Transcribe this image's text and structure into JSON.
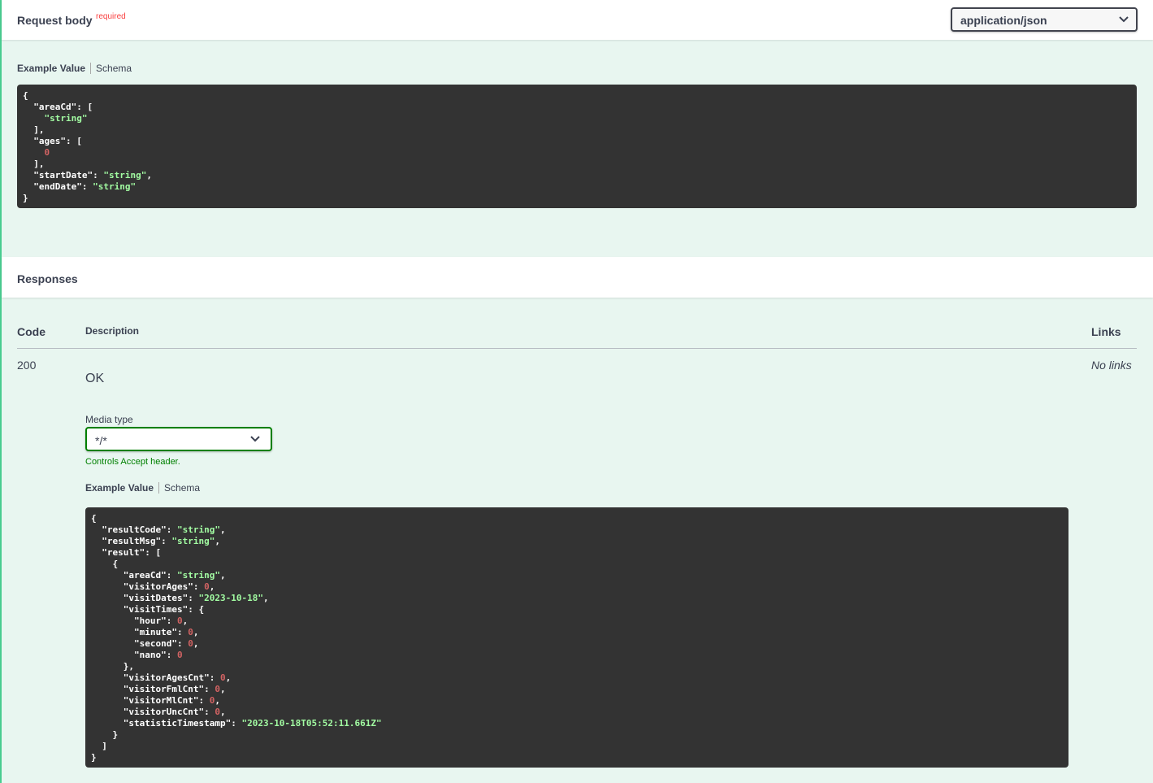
{
  "request_body": {
    "title": "Request body",
    "required": "required",
    "content_type": "application/json",
    "tabs": {
      "example": "Example Value",
      "schema": "Schema"
    },
    "code_lines": [
      [
        [
          "p",
          "{"
        ]
      ],
      [
        [
          "p",
          "  "
        ],
        [
          "k",
          "\"areaCd\""
        ],
        [
          "p",
          ": ["
        ]
      ],
      [
        [
          "p",
          "    "
        ],
        [
          "s",
          "\"string\""
        ]
      ],
      [
        [
          "p",
          "  ],"
        ]
      ],
      [
        [
          "p",
          "  "
        ],
        [
          "k",
          "\"ages\""
        ],
        [
          "p",
          ": ["
        ]
      ],
      [
        [
          "p",
          "    "
        ],
        [
          "n",
          "0"
        ]
      ],
      [
        [
          "p",
          "  ],"
        ]
      ],
      [
        [
          "p",
          "  "
        ],
        [
          "k",
          "\"startDate\""
        ],
        [
          "p",
          ": "
        ],
        [
          "s",
          "\"string\""
        ],
        [
          "p",
          ","
        ]
      ],
      [
        [
          "p",
          "  "
        ],
        [
          "k",
          "\"endDate\""
        ],
        [
          "p",
          ": "
        ],
        [
          "s",
          "\"string\""
        ]
      ],
      [
        [
          "p",
          "}"
        ]
      ]
    ]
  },
  "responses": {
    "title": "Responses",
    "columns": {
      "code": "Code",
      "description": "Description",
      "links": "Links"
    },
    "row": {
      "code": "200",
      "description": "OK",
      "links": "No links",
      "media_type_label": "Media type",
      "media_type": "*/*",
      "controls_accept": "Controls Accept header.",
      "tabs": {
        "example": "Example Value",
        "schema": "Schema"
      },
      "code_lines": [
        [
          [
            "p",
            "{"
          ]
        ],
        [
          [
            "p",
            "  "
          ],
          [
            "k",
            "\"resultCode\""
          ],
          [
            "p",
            ": "
          ],
          [
            "s",
            "\"string\""
          ],
          [
            "p",
            ","
          ]
        ],
        [
          [
            "p",
            "  "
          ],
          [
            "k",
            "\"resultMsg\""
          ],
          [
            "p",
            ": "
          ],
          [
            "s",
            "\"string\""
          ],
          [
            "p",
            ","
          ]
        ],
        [
          [
            "p",
            "  "
          ],
          [
            "k",
            "\"result\""
          ],
          [
            "p",
            ": ["
          ]
        ],
        [
          [
            "p",
            "    {"
          ]
        ],
        [
          [
            "p",
            "      "
          ],
          [
            "k",
            "\"areaCd\""
          ],
          [
            "p",
            ": "
          ],
          [
            "s",
            "\"string\""
          ],
          [
            "p",
            ","
          ]
        ],
        [
          [
            "p",
            "      "
          ],
          [
            "k",
            "\"visitorAges\""
          ],
          [
            "p",
            ": "
          ],
          [
            "n",
            "0"
          ],
          [
            "p",
            ","
          ]
        ],
        [
          [
            "p",
            "      "
          ],
          [
            "k",
            "\"visitDates\""
          ],
          [
            "p",
            ": "
          ],
          [
            "s",
            "\"2023-10-18\""
          ],
          [
            "p",
            ","
          ]
        ],
        [
          [
            "p",
            "      "
          ],
          [
            "k",
            "\"visitTimes\""
          ],
          [
            "p",
            ": {"
          ]
        ],
        [
          [
            "p",
            "        "
          ],
          [
            "k",
            "\"hour\""
          ],
          [
            "p",
            ": "
          ],
          [
            "n",
            "0"
          ],
          [
            "p",
            ","
          ]
        ],
        [
          [
            "p",
            "        "
          ],
          [
            "k",
            "\"minute\""
          ],
          [
            "p",
            ": "
          ],
          [
            "n",
            "0"
          ],
          [
            "p",
            ","
          ]
        ],
        [
          [
            "p",
            "        "
          ],
          [
            "k",
            "\"second\""
          ],
          [
            "p",
            ": "
          ],
          [
            "n",
            "0"
          ],
          [
            "p",
            ","
          ]
        ],
        [
          [
            "p",
            "        "
          ],
          [
            "k",
            "\"nano\""
          ],
          [
            "p",
            ": "
          ],
          [
            "n",
            "0"
          ]
        ],
        [
          [
            "p",
            "      },"
          ]
        ],
        [
          [
            "p",
            "      "
          ],
          [
            "k",
            "\"visitorAgesCnt\""
          ],
          [
            "p",
            ": "
          ],
          [
            "n",
            "0"
          ],
          [
            "p",
            ","
          ]
        ],
        [
          [
            "p",
            "      "
          ],
          [
            "k",
            "\"visitorFmlCnt\""
          ],
          [
            "p",
            ": "
          ],
          [
            "n",
            "0"
          ],
          [
            "p",
            ","
          ]
        ],
        [
          [
            "p",
            "      "
          ],
          [
            "k",
            "\"visitorMlCnt\""
          ],
          [
            "p",
            ": "
          ],
          [
            "n",
            "0"
          ],
          [
            "p",
            ","
          ]
        ],
        [
          [
            "p",
            "      "
          ],
          [
            "k",
            "\"visitorUncCnt\""
          ],
          [
            "p",
            ": "
          ],
          [
            "n",
            "0"
          ],
          [
            "p",
            ","
          ]
        ],
        [
          [
            "p",
            "      "
          ],
          [
            "k",
            "\"statisticTimestamp\""
          ],
          [
            "p",
            ": "
          ],
          [
            "s",
            "\"2023-10-18T05:52:11.661Z\""
          ]
        ],
        [
          [
            "p",
            "    }"
          ]
        ],
        [
          [
            "p",
            "  ]"
          ]
        ],
        [
          [
            "p",
            "}"
          ]
        ]
      ]
    }
  },
  "colors": {
    "background": "#e8f6f0",
    "accent_green": "#49cc90",
    "code_bg": "#333333",
    "string": "#a2fca2",
    "number": "#d36363",
    "required": "#f93e3e",
    "media_border": "#008000"
  },
  "icons": {
    "select_arrow": "chevron-down-icon"
  }
}
